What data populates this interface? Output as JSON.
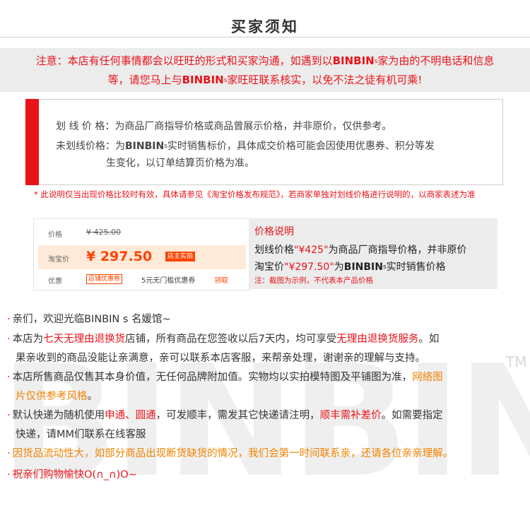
{
  "title": "买家须知",
  "brand": {
    "name": "BINBIN",
    "suffix": "s"
  },
  "notice": {
    "l1_a": "注意：本店有任何事情都会以旺旺的形式和买家沟通，如遇到以",
    "l1_b": "家为由的不明电话和信息",
    "l2_a": "等，请您马上与",
    "l2_b": "家旺旺联系核实，以免不法之徒有机可乘!"
  },
  "explain": {
    "line1": "划 线 价 格：为商品厂商指导价格或商品曾展示价格，并非原价，仅供参考。",
    "line2_a": "未划线价格：为",
    "line2_b": "实时销售标价，具体成交价格可能会因使用优惠券、积分等发",
    "line3": "生变化，以订单结算页价格为准。"
  },
  "asterisk": "* 此说明仅当出现价格比较时有效，具体请参见《淘宝价格发布规范》，若商家单独对划线价格进行说明的，以商家表述为准",
  "demo": {
    "label_price": "价格",
    "strike_price": "¥ 425.00",
    "label_taobao": "淘宝价",
    "sale_price": "¥ 297.50",
    "sale_tag": "店主实拍",
    "label_discount": "优惠",
    "coupon_tag": "店铺优惠券",
    "coupon_text": "5元无门槛优惠券",
    "coupon_link": "领取"
  },
  "price_explain": {
    "heading": "价格说明",
    "l1_a": "划线价格",
    "l1_b": "\"¥425\"",
    "l1_c": "为商品厂商指导价格，并非原价",
    "l2_a": "淘宝价",
    "l2_b": "\"¥297.50\"",
    "l2_c": "为",
    "l2_d": "实时销售价格",
    "note": "注：截图为示例，不代表本产品价格"
  },
  "bullets": {
    "b1": "亲们，欢迎光临BINBIN s 名媛馆~",
    "b2_a": "本店为",
    "b2_b": "七天无理由退换货",
    "b2_c": "店铺，所有商品在您签收以后7天内，均可享受",
    "b2_d": "无理由退换货服务",
    "b2_e": "。如",
    "b3": "果亲收到的商品没能让亲满意，亲可以联系本店客服，来帮亲处理，谢谢亲的理解与支持。",
    "b4_a": "本店所售商品仅售其本身价值，无任何品牌附加值。实物均以实拍模特图及平铺图为准，",
    "b4_b": "网络图",
    "b5": "片仅供参考风格",
    "b5_end": "。",
    "b6_a": "默认快递为随机使用",
    "b6_b": "申通、圆通",
    "b6_c": "，可发顺丰，需发其它快递请注明，",
    "b6_d": "顺丰需补差价",
    "b6_e": "。如需要指定",
    "b7": "快递，请MM们联系在线客服",
    "b8": "因货品流动性大，如部分商品出现断货缺货的情况，我们会第一时间联系亲，还请各位亲亲理解。",
    "b9": "祝亲们购物愉快O(∩_∩)O~"
  },
  "watermark": {
    "text": "BINBINs",
    "tm": "TM"
  },
  "colors": {
    "accent_red": "#e8141a",
    "orange": "#f08300",
    "grey_panel": "#ececec"
  }
}
